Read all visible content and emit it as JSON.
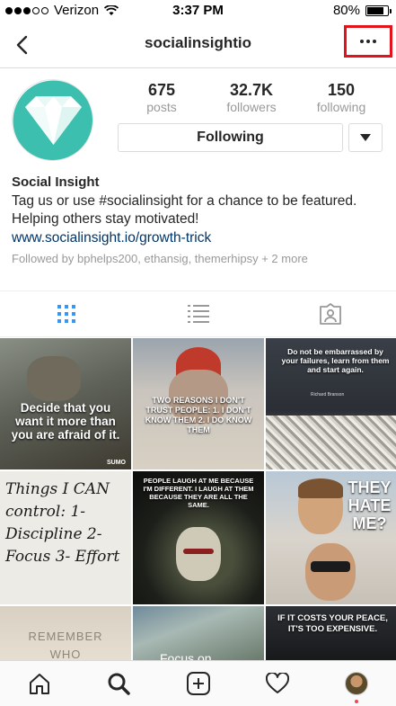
{
  "status_bar": {
    "carrier": "Verizon",
    "time": "3:37 PM",
    "battery": "80%",
    "battery_level": 0.8
  },
  "nav": {
    "title": "socialinsightio",
    "back_icon": "chevron-left-icon",
    "more_icon": "ellipsis-icon"
  },
  "stats": [
    {
      "value": "675",
      "label": "posts"
    },
    {
      "value": "32.7K",
      "label": "followers"
    },
    {
      "value": "150",
      "label": "following"
    }
  ],
  "following_button": "Following",
  "bio": {
    "name": "Social Insight",
    "text": "Tag us or use #socialinsight for a chance to be featured. Helping others stay motivated!",
    "link": "www.socialinsight.io/growth-trick",
    "followed_by": "Followed by bphelps200, ethansig, themerhipsy + 2 more"
  },
  "posts": [
    {
      "caption": "Decide that you want it more than you are afraid of it.",
      "badge": "SUMO"
    },
    {
      "caption": "TWO REASONS I DON'T TRUST PEOPLE: 1. I DON'T KNOW THEM 2. I DO KNOW THEM"
    },
    {
      "caption": "Do not be embarrassed by your failures, learn from them and start again.",
      "credit": "Richard Branson"
    },
    {
      "caption": "Things I CAN control: 1- Discipline 2- Focus 3- Effort"
    },
    {
      "caption": "PEOPLE LAUGH AT ME BECAUSE I'M DIFFERENT. I LAUGH AT THEM BECAUSE THEY ARE ALL THE SAME."
    },
    {
      "caption": "THEY HATE ME?"
    },
    {
      "caption": "REMEMBER WHO"
    },
    {
      "caption": "Focus on"
    },
    {
      "caption": "IF IT COSTS YOUR PEACE, IT'S TOO EXPENSIVE."
    }
  ],
  "tab_bar": [
    "home-icon",
    "search-icon",
    "add-post-icon",
    "heart-icon",
    "profile-avatar"
  ],
  "colors": {
    "highlight": "#e3121b",
    "link": "#003569",
    "accent": "#3897f0",
    "avatar_teal": "#3cbfae"
  }
}
